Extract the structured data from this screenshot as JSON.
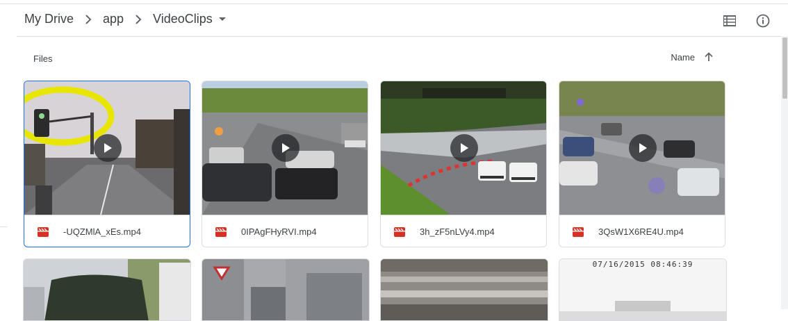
{
  "breadcrumb": {
    "items": [
      "My Drive",
      "app",
      "VideoClips"
    ]
  },
  "header": {
    "list_view_icon": "list-view-icon",
    "info_icon": "info-icon"
  },
  "section": {
    "label": "Files",
    "sort_label": "Name",
    "sort_direction_icon": "arrow-up-icon"
  },
  "files": [
    {
      "name": "-UQZMlA_xEs.mp4",
      "type_icon": "video-file-icon",
      "selected": true
    },
    {
      "name": "0IPAgFHyRVI.mp4",
      "type_icon": "video-file-icon",
      "selected": false
    },
    {
      "name": "3h_zF5nLVy4.mp4",
      "type_icon": "video-file-icon",
      "selected": false
    },
    {
      "name": "3QsW1X6RE4U.mp4",
      "type_icon": "video-file-icon",
      "selected": false
    }
  ],
  "second_row": {
    "timestamp_overlay": "07/16/2015 08:46:39"
  },
  "colors": {
    "accent": "#1a73e8",
    "file_icon_red": "#d93025",
    "border": "#dadce0"
  }
}
